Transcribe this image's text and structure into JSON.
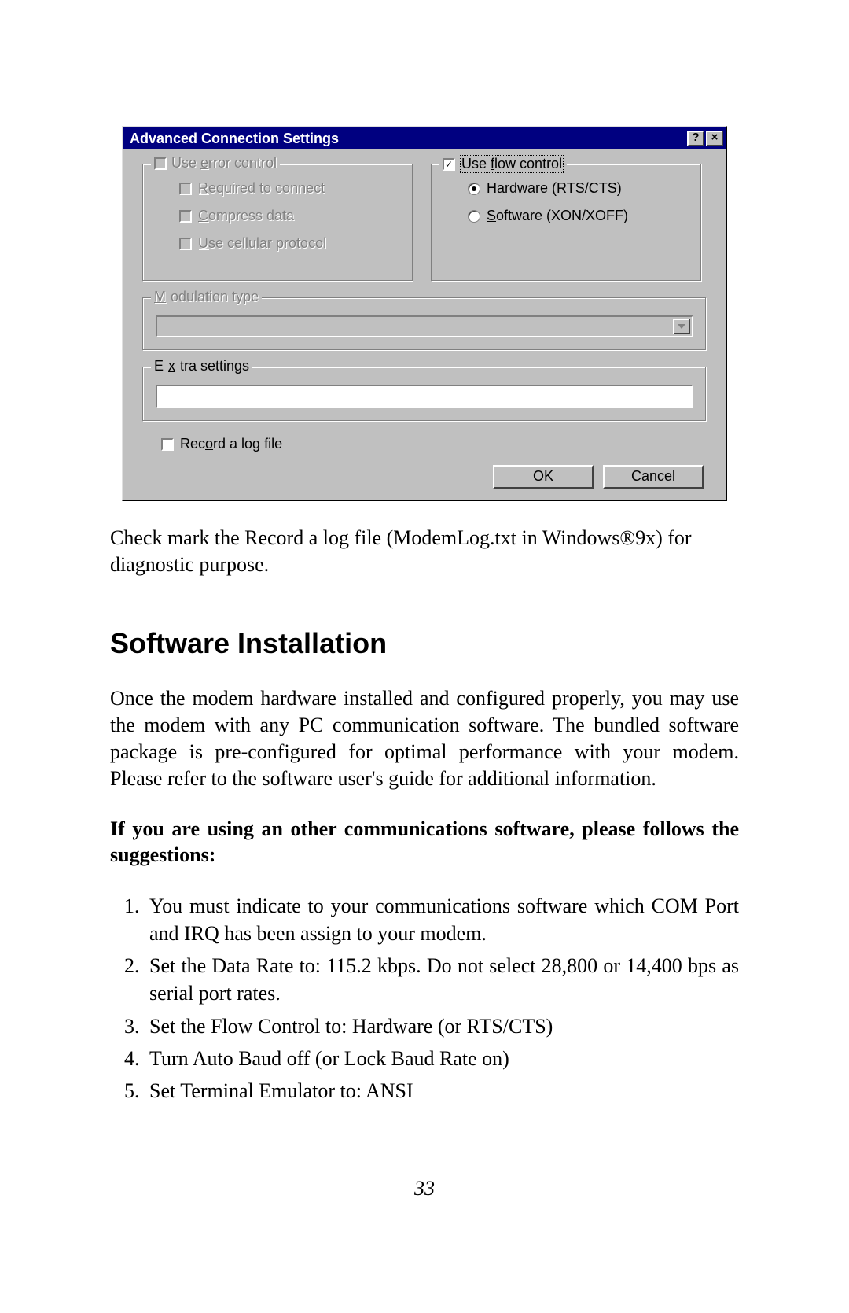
{
  "dialog": {
    "title": "Advanced Connection Settings",
    "help_btn": "?",
    "close_btn": "×",
    "error_control": {
      "legend": "Use error control",
      "required": "Required to connect",
      "compress": "Compress data",
      "cellular": "Use cellular protocol"
    },
    "flow_control": {
      "legend": "Use flow control",
      "hardware": "Hardware (RTS/CTS)",
      "software": "Software (XON/XOFF)"
    },
    "modulation_legend": "Modulation type",
    "extra_legend": "Extra settings",
    "record_log": "Record a log file",
    "ok": "OK",
    "cancel": "Cancel"
  },
  "doc": {
    "para1": "Check mark the Record a log file (ModemLog.txt in Windows®9x) for diagnostic purpose.",
    "heading": "Software  Installation",
    "para2": "Once the modem hardware installed and configured properly, you may use the modem with any PC communication software. The bundled software package is pre-configured for optimal performance with your modem. Please refer to the software user's guide for additional information.",
    "bold_para": "If you are using an other communications software,  please follows the suggestions:",
    "list": [
      "You must indicate to your communications software which COM Port and IRQ has been assign to your modem.",
      "Set the Data Rate to: 115.2 kbps. Do not select 28,800 or 14,400 bps as serial port rates.",
      "Set the Flow Control to: Hardware (or RTS/CTS)",
      "Turn Auto Baud off (or Lock Baud Rate on)",
      "Set Terminal Emulator to: ANSI"
    ],
    "page_number": "33"
  }
}
